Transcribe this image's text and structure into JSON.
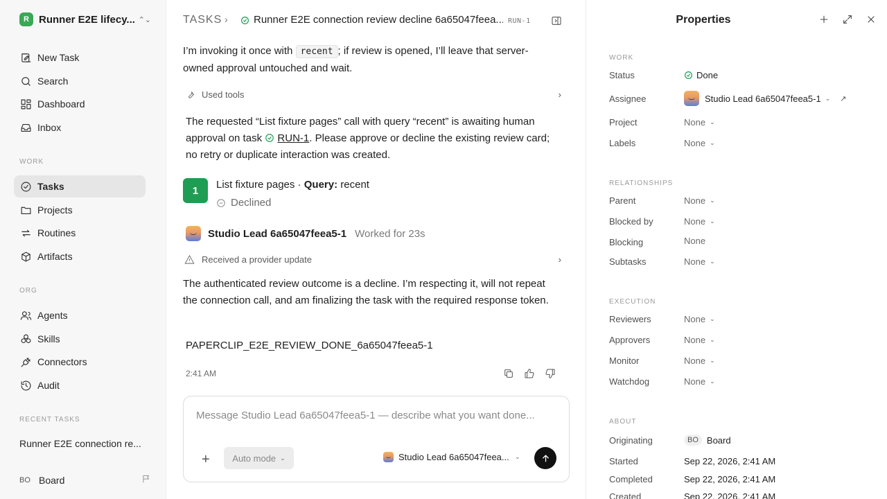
{
  "sidebar": {
    "workspace_name": "Runner E2E lifecy...",
    "workspace_logo": "R",
    "nav": [
      {
        "label": "New Task",
        "icon": "new-task-icon"
      },
      {
        "label": "Search",
        "icon": "search-icon"
      },
      {
        "label": "Dashboard",
        "icon": "dashboard-icon"
      },
      {
        "label": "Inbox",
        "icon": "inbox-icon"
      }
    ],
    "work_section": "WORK",
    "work_items": [
      {
        "label": "Tasks",
        "icon": "check-circle-icon",
        "active": true
      },
      {
        "label": "Projects",
        "icon": "folder-icon"
      },
      {
        "label": "Routines",
        "icon": "repeat-icon"
      },
      {
        "label": "Artifacts",
        "icon": "box-icon"
      }
    ],
    "org_section": "ORG",
    "org_items": [
      {
        "label": "Agents",
        "icon": "users-icon"
      },
      {
        "label": "Skills",
        "icon": "skills-icon"
      },
      {
        "label": "Connectors",
        "icon": "plug-icon"
      },
      {
        "label": "Audit",
        "icon": "history-icon"
      }
    ],
    "recent_section": "RECENT TASKS",
    "recent_item": "Runner E2E connection re...",
    "board_badge": "BO",
    "board_name": "Board"
  },
  "header": {
    "crumb_root": "TASKS",
    "crumb_sep": "›",
    "title": "Runner E2E connection review decline 6a65047feea...",
    "task_id": "RUN-1"
  },
  "conversation": {
    "intro_pre": "I’m invoking it once with ",
    "intro_code": "recent",
    "intro_post": "; if review is opened, I’ll leave that server-owned approval untouched and wait.",
    "used_tools": "Used tools",
    "awaiting_pre": "The requested “List fixture pages” call with query “recent” is awaiting human approval on task ",
    "awaiting_link": "RUN-1",
    "awaiting_post": ". Please approve or decline the existing review card; no retry or duplicate interaction was created.",
    "tool_number": "1",
    "tool_name": "List fixture pages · ",
    "tool_query_label": "Query:",
    "tool_query_value": " recent",
    "tool_status": "Declined",
    "author": "Studio Lead 6a65047feea5-1",
    "worked": "Worked for 23s",
    "provider_update": "Received a provider update",
    "outcome": "The authenticated review outcome is a decline. I’m respecting it, will not repeat the connection call, and am finalizing the task with the required response token.",
    "token": "PAPERCLIP_E2E_REVIEW_DONE_6a65047feea5-1",
    "time": "2:41 AM"
  },
  "composer": {
    "placeholder": "Message Studio Lead 6a65047feea5-1 — describe what you want done...",
    "value": "",
    "mode": "Auto mode",
    "agent": "Studio Lead 6a65047feea..."
  },
  "properties": {
    "title": "Properties",
    "work_section": "WORK",
    "status_label": "Status",
    "status_value": "Done",
    "assignee_label": "Assignee",
    "assignee_value": "Studio Lead 6a65047feea5-1",
    "project_label": "Project",
    "project_value": "None",
    "labels_label": "Labels",
    "labels_value": "None",
    "rel_section": "RELATIONSHIPS",
    "parent_label": "Parent",
    "parent_value": "None",
    "blocked_label": "Blocked by",
    "blocked_value": "None",
    "blocking_label": "Blocking",
    "blocking_value": "None",
    "subtasks_label": "Subtasks",
    "subtasks_value": "None",
    "exec_section": "EXECUTION",
    "reviewers_label": "Reviewers",
    "reviewers_value": "None",
    "approvers_label": "Approvers",
    "approvers_value": "None",
    "monitor_label": "Monitor",
    "monitor_value": "None",
    "watchdog_label": "Watchdog",
    "watchdog_value": "None",
    "about_section": "ABOUT",
    "originating_label": "Originating",
    "originating_badge": "BO",
    "originating_value": "Board",
    "started_label": "Started",
    "started_value": "Sep 22, 2026, 2:41 AM",
    "completed_label": "Completed",
    "completed_value": "Sep 22, 2026, 2:41 AM",
    "created_label": "Created",
    "created_value": "Sep 22, 2026, 2:41 AM"
  },
  "colors": {
    "accent_green": "#1f9d55",
    "sidebar_bg": "#f7f7f7",
    "active_bg": "#e6e6e6"
  }
}
